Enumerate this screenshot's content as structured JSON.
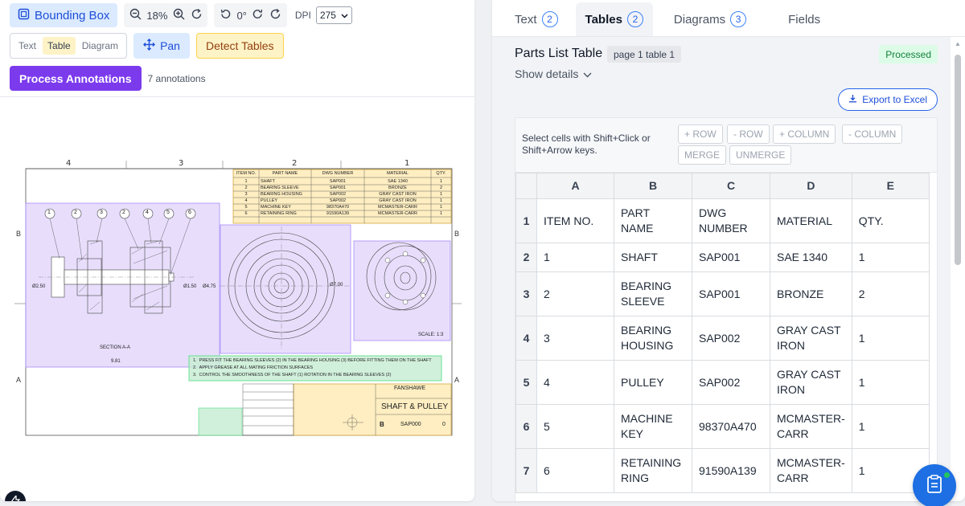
{
  "toolbar": {
    "bounding_box_label": "Bounding Box",
    "zoom_value": "18%",
    "rotation_value": "0°",
    "dpi_label": "DPI",
    "dpi_value": "275",
    "modes": [
      "Text",
      "Table",
      "Diagram"
    ],
    "active_mode": "Table",
    "pan_label": "Pan",
    "detect_label": "Detect Tables",
    "process_label": "Process Annotations",
    "annotation_count": "7 annotations"
  },
  "drawing": {
    "top_zones": [
      "4",
      "3",
      "2",
      "1"
    ],
    "side_rows": [
      "B",
      "A"
    ],
    "parts_table": {
      "headers": [
        "ITEM NO.",
        "PART NAME",
        "DWG NUMBER",
        "MATERIAL",
        "QTY."
      ],
      "rows": [
        [
          "1",
          "SHAFT",
          "SAP001",
          "SAE 1340",
          "1"
        ],
        [
          "2",
          "BEARING SLEEVE",
          "SAP001",
          "BRONZE",
          "2"
        ],
        [
          "3",
          "BEARING HOUSING",
          "SAP002",
          "GRAY CAST IRON",
          "1"
        ],
        [
          "4",
          "PULLEY",
          "SAP002",
          "GRAY CAST IRON",
          "1"
        ],
        [
          "5",
          "MACHINE KEY",
          "98370A470",
          "MCMASTER-CARR",
          "1"
        ],
        [
          "6",
          "RETAINING RING",
          "91590A139",
          "MCMASTER-CARR",
          "1"
        ]
      ]
    },
    "balloons": [
      "1",
      "2",
      "3",
      "2",
      "4",
      "5",
      "6"
    ],
    "dims": {
      "left": "Ø2.50",
      "mid1": "Ø1.50",
      "mid2": "Ø4.75",
      "pulley": "Ø7.00",
      "length": "9.81"
    },
    "section_label": "SECTION A-A",
    "scale_label": "SCALE: 1:3",
    "notes": [
      "PRESS FIT THE BEARING SLEEVES (2) IN THE BEARING HOUSING (3) BEFORE FITTING THEM ON THE SHAFT",
      "APPLY GREASE AT ALL MATING FRICTION SURFACES",
      "CONTROL THE SMOOTHNESS OF THE SHAFT (1) ROTATION IN THE BEARING SLEEVES (2)"
    ],
    "title_block": {
      "company": "FANSHAWE",
      "title": "SHAFT & PULLEY",
      "size": "B",
      "dwg_no": "SAP000",
      "rev": "0"
    }
  },
  "tabs": [
    {
      "label": "Text",
      "count": "2"
    },
    {
      "label": "Tables",
      "count": "2"
    },
    {
      "label": "Diagrams",
      "count": "3"
    },
    {
      "label": "Fields",
      "count": ""
    }
  ],
  "active_tab": "Tables",
  "panel": {
    "title": "Parts List Table",
    "tag": "page 1 table 1",
    "status": "Processed",
    "show_details": "Show details",
    "export_label": "Export to Excel",
    "hint": "Select cells with Shift+Click or Shift+Arrow keys.",
    "buttons": [
      "+ ROW",
      "- ROW",
      "+ COLUMN",
      "- COLUMN",
      "MERGE",
      "UNMERGE"
    ]
  },
  "sheet": {
    "columns": [
      "A",
      "B",
      "C",
      "D",
      "E"
    ],
    "rows": [
      {
        "num": "1",
        "cells": [
          "ITEM NO.",
          "PART NAME",
          "DWG NUMBER",
          "MATERIAL",
          "QTY."
        ]
      },
      {
        "num": "2",
        "cells": [
          "1",
          "SHAFT",
          "SAP001",
          "SAE 1340",
          "1"
        ]
      },
      {
        "num": "3",
        "cells": [
          "2",
          "BEARING SLEEVE",
          "SAP001",
          "BRONZE",
          "2"
        ]
      },
      {
        "num": "4",
        "cells": [
          "3",
          "BEARING HOUSING",
          "SAP002",
          "GRAY CAST IRON",
          "1"
        ]
      },
      {
        "num": "5",
        "cells": [
          "4",
          "PULLEY",
          "SAP002",
          "GRAY CAST IRON",
          "1"
        ]
      },
      {
        "num": "6",
        "cells": [
          "5",
          "MACHINE KEY",
          "98370A470",
          "MCMASTER-CARR",
          "1"
        ]
      },
      {
        "num": "7",
        "cells": [
          "6",
          "RETAINING RING",
          "91590A139",
          "MCMASTER-CARR",
          "1"
        ]
      }
    ]
  },
  "colors": {
    "accent": "#2563eb",
    "process": "#7c3aed",
    "table_overlay": "#fde7a8",
    "diagram_overlay": "#dccdfb",
    "text_overlay": "#c6ecd2",
    "status_green": "#15803d"
  }
}
